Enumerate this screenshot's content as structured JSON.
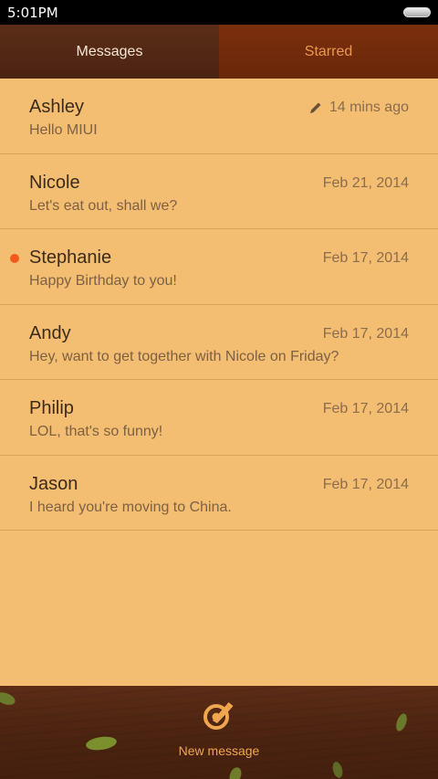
{
  "status_bar": {
    "time": "5:01PM"
  },
  "tabs": [
    {
      "label": "Messages",
      "active": true
    },
    {
      "label": "Starred",
      "active": false
    }
  ],
  "messages": [
    {
      "name": "Ashley",
      "preview": "Hello MIUI",
      "time": "14 mins ago",
      "draft": true,
      "unread": false
    },
    {
      "name": "Nicole",
      "preview": "Let's eat out, shall we?",
      "time": "Feb 21, 2014",
      "draft": false,
      "unread": false
    },
    {
      "name": "Stephanie",
      "preview": "Happy Birthday to you!",
      "time": "Feb 17, 2014",
      "draft": false,
      "unread": true
    },
    {
      "name": "Andy",
      "preview": "Hey, want to get together with Nicole on Friday?",
      "time": "Feb 17, 2014",
      "draft": false,
      "unread": false
    },
    {
      "name": "Philip",
      "preview": "LOL, that's so funny!",
      "time": "Feb 17, 2014",
      "draft": false,
      "unread": false
    },
    {
      "name": "Jason",
      "preview": "I heard you're moving to China.",
      "time": "Feb 17, 2014",
      "draft": false,
      "unread": false
    }
  ],
  "bottom_bar": {
    "compose_label": "New message",
    "compose_icon": "compose-icon"
  },
  "colors": {
    "background": "#f3bd72",
    "accent": "#f0a64f",
    "unread_dot": "#f25a1d",
    "tab_active": "#4b2412",
    "tab_inactive": "#6a270a"
  }
}
